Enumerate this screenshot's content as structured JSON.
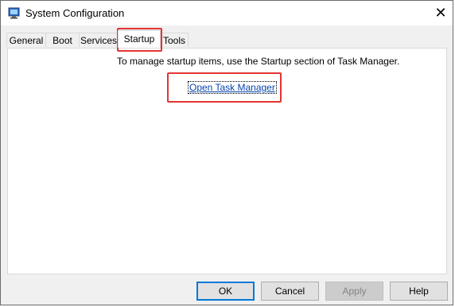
{
  "window": {
    "title": "System Configuration",
    "close_glyph": "✕",
    "icon": "system-config-icon"
  },
  "tabs": [
    {
      "label": "General"
    },
    {
      "label": "Boot"
    },
    {
      "label": "Services"
    },
    {
      "label": "Startup",
      "active": true
    },
    {
      "label": "Tools"
    }
  ],
  "startup": {
    "message": "To manage startup items, use the Startup section of Task Manager.",
    "link_label": "Open Task Manager"
  },
  "buttons": {
    "ok": "OK",
    "cancel": "Cancel",
    "apply": "Apply",
    "help": "Help"
  },
  "annotation_color": "#e53333"
}
